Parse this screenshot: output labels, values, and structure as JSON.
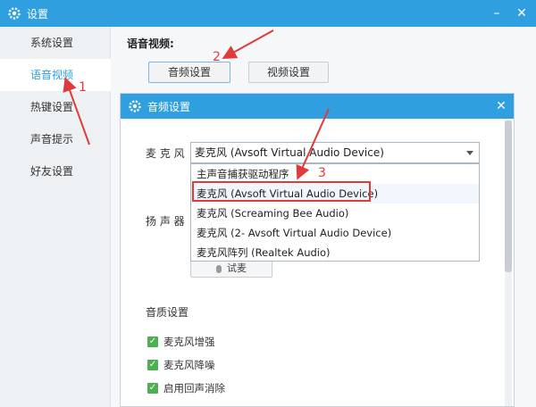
{
  "window": {
    "title": "设置"
  },
  "sidebar": {
    "items": [
      {
        "label": "系统设置"
      },
      {
        "label": "语音视频"
      },
      {
        "label": "热键设置"
      },
      {
        "label": "声音提示"
      },
      {
        "label": "好友设置"
      }
    ]
  },
  "main": {
    "section_title": "语音视频:",
    "audio_button": "音频设置",
    "video_button": "视频设置"
  },
  "dialog": {
    "title": "音频设置",
    "mic_label": "麦 克 风",
    "mic_value": "麦克风 (Avsoft Virtual Audio Device)",
    "speaker_label": "扬 声 器",
    "options": [
      "主声音捕获驱动程序",
      "麦克风 (Avsoft Virtual Audio Device)",
      "麦克风 (Screaming Bee Audio)",
      "麦克风 (2- Avsoft Virtual Audio Device)",
      "麦克风阵列 (Realtek Audio)"
    ],
    "test_button": "试麦",
    "quality_title": "音质设置",
    "checks": [
      {
        "label": "麦克风增强",
        "checked": true
      },
      {
        "label": "麦克风降噪",
        "checked": true
      },
      {
        "label": "启用回声消除",
        "checked": true
      }
    ]
  },
  "annotations": {
    "step1": "1",
    "step2": "2",
    "step3": "3"
  },
  "colors": {
    "accent": "#2f9fe0",
    "annotation": "#e03a3a",
    "check": "#4caf50"
  }
}
